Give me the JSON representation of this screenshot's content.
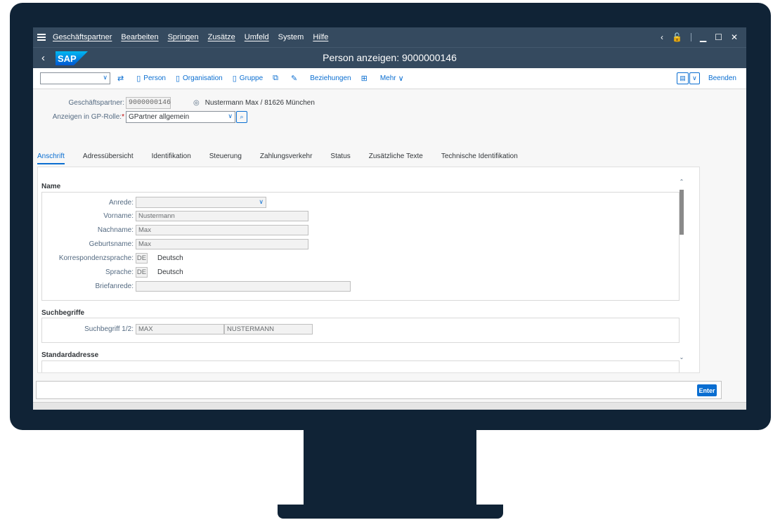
{
  "menu": [
    "Geschäftspartner",
    "Bearbeiten",
    "Springen",
    "Zusätze",
    "Umfeld",
    "System",
    "Hilfe"
  ],
  "title": "Person anzeigen: 9000000146",
  "logo_text": "SAP",
  "toolbar": {
    "person": "Person",
    "organisation": "Organisation",
    "gruppe": "Gruppe",
    "beziehungen": "Beziehungen",
    "mehr": "Mehr",
    "beenden": "Beenden"
  },
  "header": {
    "gp_label": "Geschäftspartner:",
    "gp_value": "9000000146",
    "gp_desc": "Nustermann Max / 81626 München",
    "role_label": "Anzeigen in GP-Rolle:",
    "role_value": "GPartner allgemein"
  },
  "tabs": [
    "Anschrift",
    "Adressübersicht",
    "Identifikation",
    "Steuerung",
    "Zahlungsverkehr",
    "Status",
    "Zusätzliche Texte",
    "Technische Identifikation"
  ],
  "sections": {
    "name": "Name",
    "suchbegriffe": "Suchbegriffe",
    "standardadresse": "Standardadresse"
  },
  "name_fields": {
    "anrede_label": "Anrede:",
    "vorname_label": "Vorname:",
    "vorname_value": "Nustermann",
    "nachname_label": "Nachname:",
    "nachname_value": "Max",
    "geburtsname_label": "Geburtsname:",
    "geburtsname_value": "Max",
    "korr_label": "Korrespondenzsprache:",
    "korr_code": "DE",
    "korr_text": "Deutsch",
    "sprache_label": "Sprache:",
    "sprache_code": "DE",
    "sprache_text": "Deutsch",
    "briefanrede_label": "Briefanrede:"
  },
  "such_fields": {
    "label": "Suchbegriff 1/2:",
    "value1": "MAX",
    "value2": "NUSTERMANN"
  },
  "enter_label": "Enter"
}
